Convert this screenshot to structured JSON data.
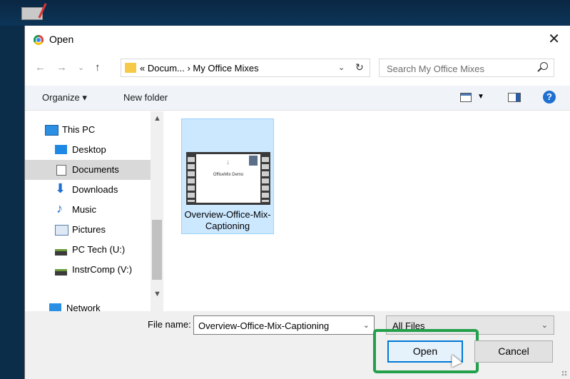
{
  "window": {
    "title": "Open"
  },
  "nav": {
    "back": "←",
    "forward": "→",
    "recent": "⌄",
    "up": "↑",
    "address": "« Docum... › My Office Mixes",
    "refresh": "↻",
    "dropdown": "⌄",
    "search_placeholder": "Search My Office Mixes"
  },
  "toolbar": {
    "organize": "Organize ▾",
    "new_folder": "New folder",
    "help": "?"
  },
  "sidebar": {
    "items": [
      {
        "label": "This PC",
        "icon": "pc-icon"
      },
      {
        "label": "Desktop",
        "icon": "desktop-icon"
      },
      {
        "label": "Documents",
        "icon": "documents-icon",
        "selected": true
      },
      {
        "label": "Downloads",
        "icon": "downloads-icon"
      },
      {
        "label": "Music",
        "icon": "music-icon"
      },
      {
        "label": "Pictures",
        "icon": "pictures-icon"
      },
      {
        "label": "PC Tech (U:)",
        "icon": "network-drive-icon"
      },
      {
        "label": "InstrComp (V:)",
        "icon": "network-drive-icon"
      },
      {
        "label": "Network",
        "icon": "network-icon"
      }
    ]
  },
  "files": [
    {
      "name": "Overview-Office-Mix-Captioning",
      "thumb_title": "OfficeMix Demo"
    }
  ],
  "footer": {
    "file_name_label": "File name:",
    "file_name_value": "Overview-Office-Mix-Captioning",
    "filter": "All Files",
    "open": "Open",
    "cancel": "Cancel"
  },
  "colors": {
    "accent": "#0078d7",
    "highlight": "#22a04a",
    "selection": "#cce8ff"
  }
}
